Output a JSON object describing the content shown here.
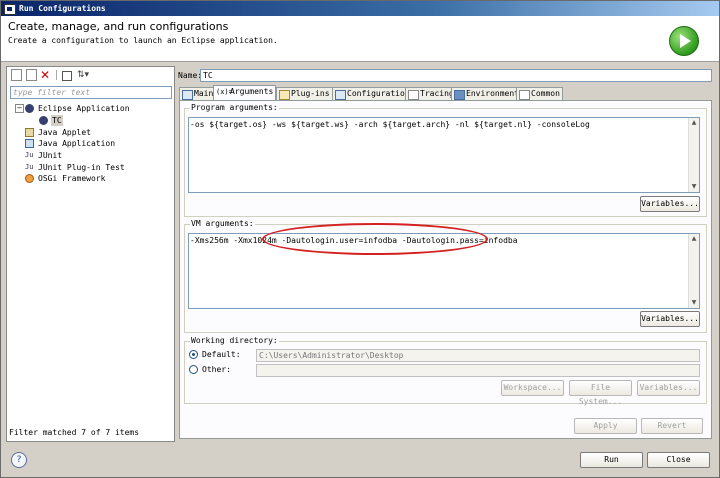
{
  "window": {
    "title": "Run Configurations"
  },
  "header": {
    "title": "Create, manage, and run configurations",
    "subtitle": "Create a configuration to launch an Eclipse application."
  },
  "left": {
    "filter_placeholder": "type filter text",
    "tree": [
      {
        "label": "Eclipse Application",
        "icon": "eclipse-icon",
        "expanded": true
      },
      {
        "label": "TC",
        "icon": "eclipse-icon",
        "selected": true
      },
      {
        "label": "Java Applet",
        "icon": "applet-icon"
      },
      {
        "label": "Java Application",
        "icon": "java-app-icon"
      },
      {
        "label": "JUnit",
        "icon": "junit-icon"
      },
      {
        "label": "JUnit Plug-in Test",
        "icon": "junit-plugin-icon"
      },
      {
        "label": "OSGi Framework",
        "icon": "osgi-icon"
      }
    ],
    "status": "Filter matched 7 of 7 items"
  },
  "right": {
    "name_label": "Name:",
    "name_value": "TC",
    "tabs": [
      "Main",
      "Arguments",
      "Plug-ins",
      "Configuration",
      "Tracing",
      "Environment",
      "Common"
    ],
    "active_tab": "Arguments",
    "program_args_label": "Program arguments:",
    "program_args": "-os ${target.os} -ws ${target.ws} -arch ${target.arch} -nl ${target.nl} -consoleLog",
    "variables_label": "Variables...",
    "vm_args_label": "VM arguments:",
    "vm_args": "-Xms256m -Xmx1024m -Dautologin.user=infodba -Dautologin.pass=infodba",
    "working_dir_label": "Working directory:",
    "default_label": "Default:",
    "default_value": "C:\\Users\\Administrator\\Desktop",
    "other_label": "Other:",
    "workspace_label": "Workspace...",
    "filesystem_label": "File System...",
    "variables2_label": "Variables...",
    "apply_label": "Apply",
    "revert_label": "Revert"
  },
  "footer": {
    "run_label": "Run",
    "close_label": "Close"
  },
  "colors": {
    "annotation": "#d42020",
    "run_logo": "#2f9a1e"
  }
}
